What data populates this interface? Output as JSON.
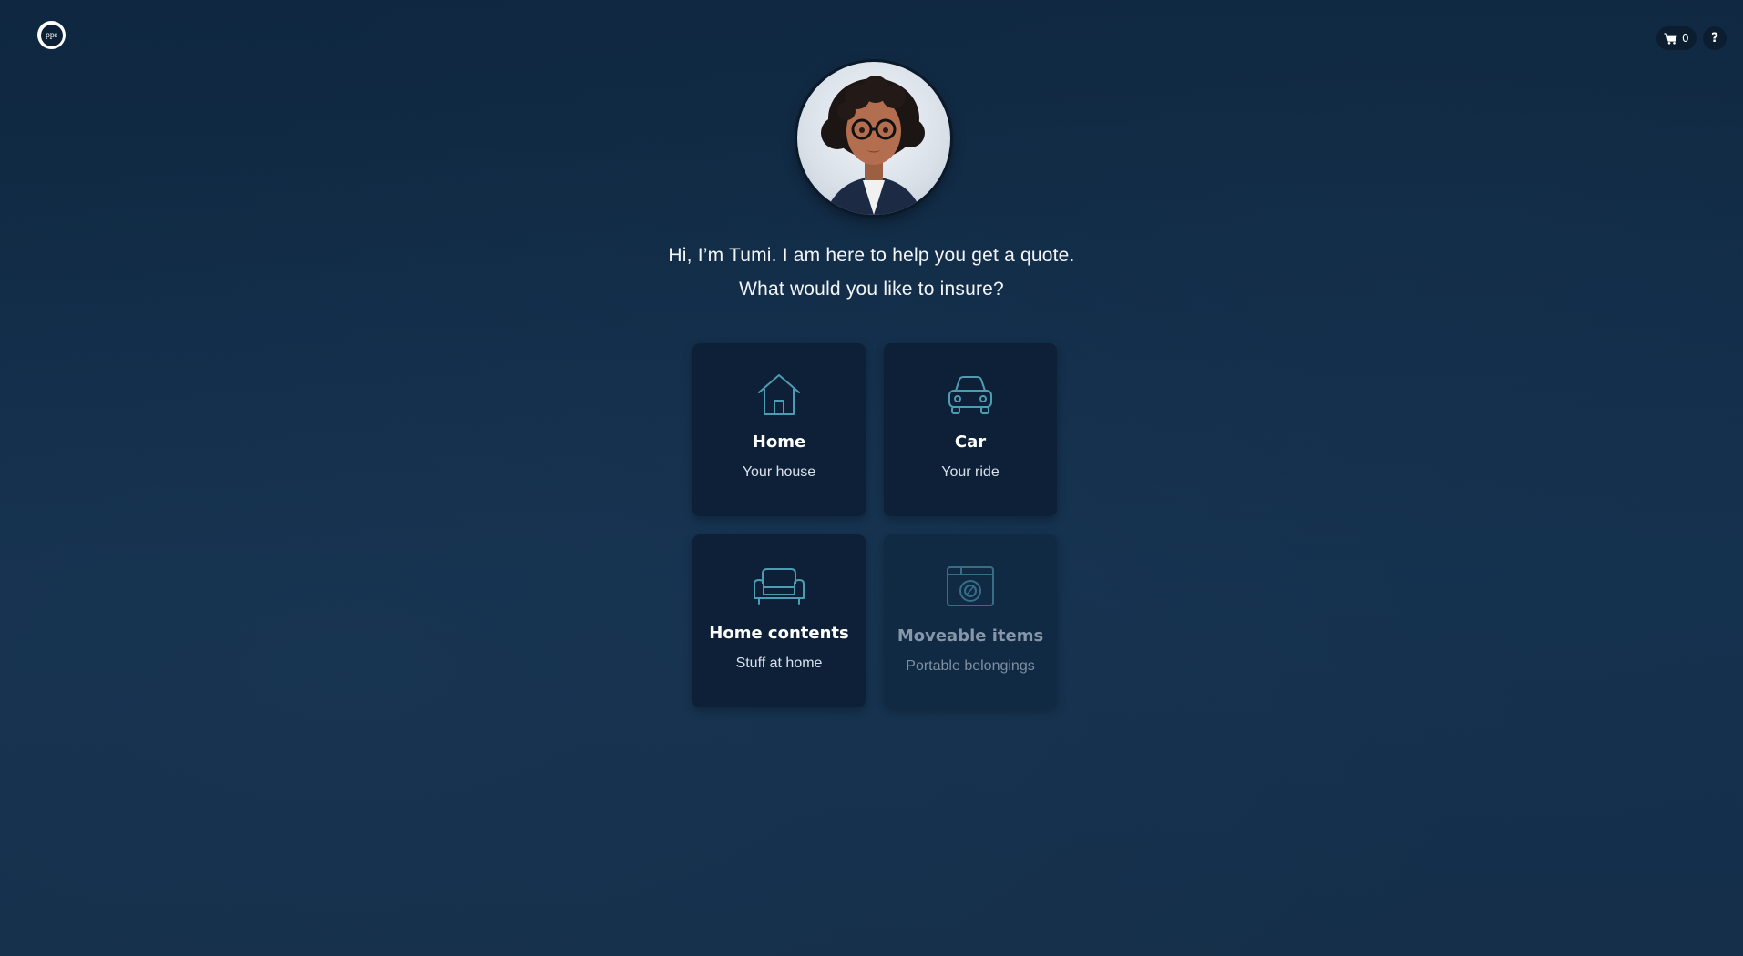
{
  "header": {
    "logo_text": "pps",
    "cart_count": "0",
    "help_label": "?"
  },
  "assistant": {
    "greeting_line1": "Hi, I’m Tumi. I am here to help you get a quote.",
    "greeting_line2": "What would you like to insure?"
  },
  "options": [
    {
      "title": "Home",
      "subtitle": "Your house",
      "icon": "house-icon",
      "enabled": true
    },
    {
      "title": "Car",
      "subtitle": "Your ride",
      "icon": "car-icon",
      "enabled": true
    },
    {
      "title": "Home contents",
      "subtitle": "Stuff at home",
      "icon": "sofa-icon",
      "enabled": true
    },
    {
      "title": "Moveable items",
      "subtitle": "Portable belongings",
      "icon": "camera-icon",
      "enabled": false
    }
  ],
  "colors": {
    "background": "#13304d",
    "card": "#0d2038",
    "icon_stroke": "#4e9cb3"
  }
}
